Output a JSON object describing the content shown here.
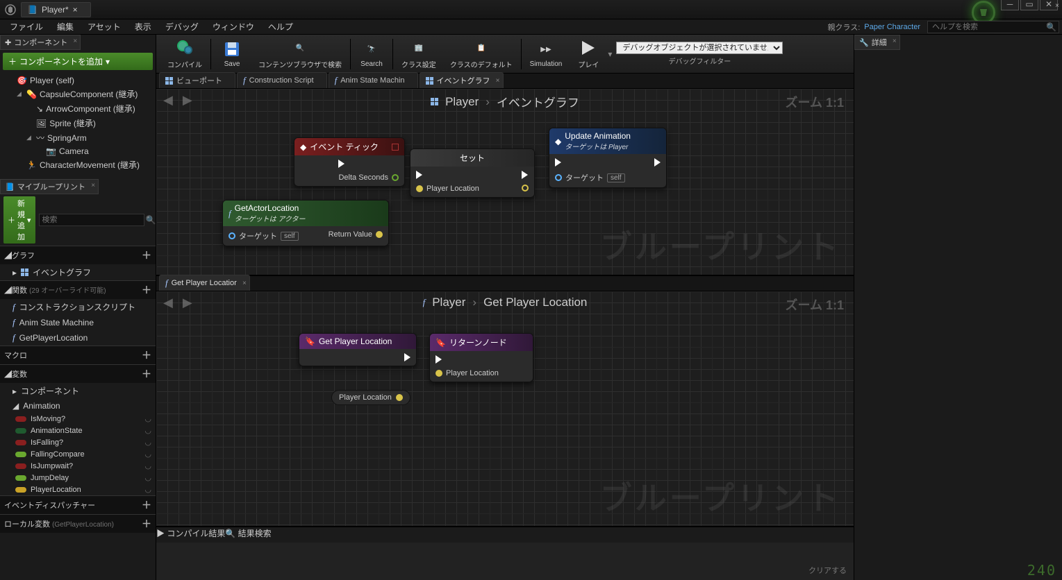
{
  "title_tab": "Player*",
  "menubar": [
    "ファイル",
    "編集",
    "アセット",
    "表示",
    "デバッグ",
    "ウィンドウ",
    "ヘルプ"
  ],
  "parent_class_label": "親クラス:",
  "parent_class_value": "Paper Character",
  "help_placeholder": "ヘルプを検索",
  "left": {
    "components_tab": "コンポーネント",
    "add_component_btn": "コンポーネントを追加",
    "tree": [
      {
        "label": "Player (self)",
        "indent": 0,
        "icon": "target"
      },
      {
        "label": "CapsuleComponent (継承)",
        "indent": 1,
        "icon": "capsule",
        "expand": true
      },
      {
        "label": "ArrowComponent (継承)",
        "indent": 2,
        "icon": "arrow"
      },
      {
        "label": "Sprite (継承)",
        "indent": 2,
        "icon": "sprite"
      },
      {
        "label": "SpringArm",
        "indent": 2,
        "icon": "spring",
        "expand": true
      },
      {
        "label": "Camera",
        "indent": 3,
        "icon": "camera"
      },
      {
        "label": "CharacterMovement (継承)",
        "indent": 1,
        "icon": "move"
      }
    ],
    "mybp_tab": "マイブループリント",
    "add_new_btn": "新規追加",
    "search_placeholder": "検索",
    "sections": {
      "graph": "グラフ",
      "event_graph": "イベントグラフ",
      "functions": "関数",
      "functions_note": "(29 オーバーライド可能)",
      "fn_items": [
        "コンストラクションスクリプト",
        "Anim State Machine",
        "GetPlayerLocation"
      ],
      "macros": "マクロ",
      "variables": "変数",
      "var_groups": [
        "コンポーネント",
        "Animation"
      ],
      "vars": [
        {
          "name": "IsMoving?",
          "color": "#8a1f1f"
        },
        {
          "name": "AnimationState",
          "color": "#1f5a2f"
        },
        {
          "name": "IsFalling?",
          "color": "#8a1f1f"
        },
        {
          "name": "FallingCompare",
          "color": "#6aa82f"
        },
        {
          "name": "IsJumpwait?",
          "color": "#8a1f1f"
        },
        {
          "name": "JumpDelay",
          "color": "#6aa82f"
        },
        {
          "name": "PlayerLocation",
          "color": "#c9a227"
        }
      ],
      "dispatchers": "イベントディスパッチャー",
      "local_vars": "ローカル変数",
      "local_vars_note": "(GetPlayerLocation)"
    }
  },
  "toolbar": [
    {
      "label": "コンパイル",
      "icon": "gear"
    },
    {
      "label": "Save",
      "icon": "save"
    },
    {
      "label": "コンテンツブラウザで検索",
      "icon": "lens"
    },
    {
      "label": "Search",
      "icon": "lens2"
    },
    {
      "label": "クラス設定",
      "icon": "class"
    },
    {
      "label": "クラスのデフォルト",
      "icon": "defaults"
    },
    {
      "label": "Simulation",
      "icon": "sim"
    },
    {
      "label": "プレイ",
      "icon": "play"
    }
  ],
  "debug_select": "デバッグオブジェクトが選択されていません",
  "debug_filter_label": "デバッグフィルター",
  "editor_tabs": [
    {
      "label": "ビューポート",
      "icon": "grid"
    },
    {
      "label": "Construction Script",
      "icon": "fn"
    },
    {
      "label": "Anim State Machin",
      "icon": "fn"
    },
    {
      "label": "イベントグラフ",
      "icon": "grid",
      "active": true
    }
  ],
  "graph_top": {
    "crumb_a": "Player",
    "crumb_b": "イベントグラフ",
    "zoom": "ズーム 1:1",
    "watermark": "ブループリント",
    "nodes": {
      "tick": {
        "title": "イベント ティック",
        "pin_out": "Delta Seconds"
      },
      "get_actor": {
        "title": "GetActorLocation",
        "sub": "ターゲットは アクター",
        "pin_target": "ターゲット",
        "self": "self",
        "pin_ret": "Return Value"
      },
      "set": {
        "title": "セット",
        "pin": "Player Location"
      },
      "update": {
        "title": "Update Animation",
        "sub": "ターゲットは Player",
        "pin_target": "ターゲット",
        "self": "self"
      }
    }
  },
  "lower_tab": "Get Player Locatior",
  "graph_bottom": {
    "crumb_a": "Player",
    "crumb_b": "Get Player Location",
    "zoom": "ズーム 1:1",
    "watermark": "ブループリント",
    "nodes": {
      "entry": "Get Player Location",
      "return": "リターンノード",
      "return_pin": "Player Location",
      "var_pill": "Player Location"
    }
  },
  "right": {
    "tab": "詳細"
  },
  "results": {
    "tabs": [
      "コンパイル結果",
      "結果検索"
    ],
    "clear": "クリアする"
  },
  "counter": "240"
}
